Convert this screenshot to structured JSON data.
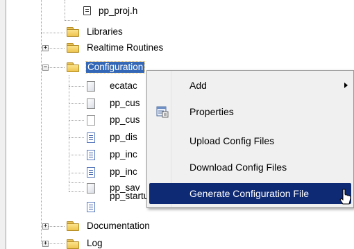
{
  "tree": {
    "items": [
      {
        "label": "pp_proj.h",
        "icon": "header-file-icon"
      },
      {
        "label": "Libraries",
        "icon": "folder-icon"
      },
      {
        "label": "Realtime Routines",
        "icon": "folder-icon",
        "expander": "+"
      },
      {
        "label": "Configuration",
        "icon": "folder-icon",
        "expander": "−",
        "selected": true
      },
      {
        "label": "ecatac",
        "icon": "config-file-icon"
      },
      {
        "label": "pp_cus",
        "icon": "config-file-icon"
      },
      {
        "label": "pp_cus",
        "icon": "blank-file-icon"
      },
      {
        "label": "pp_dis",
        "icon": "text-file-icon"
      },
      {
        "label": "pp_inc",
        "icon": "text-file-icon"
      },
      {
        "label": "pp_inc",
        "icon": "text-file-icon"
      },
      {
        "label": "pp_sav",
        "icon": "config-file-icon"
      },
      {
        "label": "pp_startup.txt",
        "icon": "text-file-icon"
      },
      {
        "label": "Documentation",
        "icon": "folder-icon",
        "expander": "+"
      },
      {
        "label": "Log",
        "icon": "folder-icon",
        "expander": "+"
      }
    ]
  },
  "context_menu": {
    "items": [
      {
        "label": "Add",
        "submenu": true
      },
      {
        "label": "Properties",
        "icon": "properties-icon"
      },
      {
        "label": "Upload Config Files"
      },
      {
        "label": "Download Config Files"
      },
      {
        "label": "Generate Configuration File",
        "highlighted": true
      }
    ]
  },
  "colors": {
    "selection": "#3468b7",
    "menu_highlight": "#0f2a74",
    "folder": "#f3cd58"
  }
}
